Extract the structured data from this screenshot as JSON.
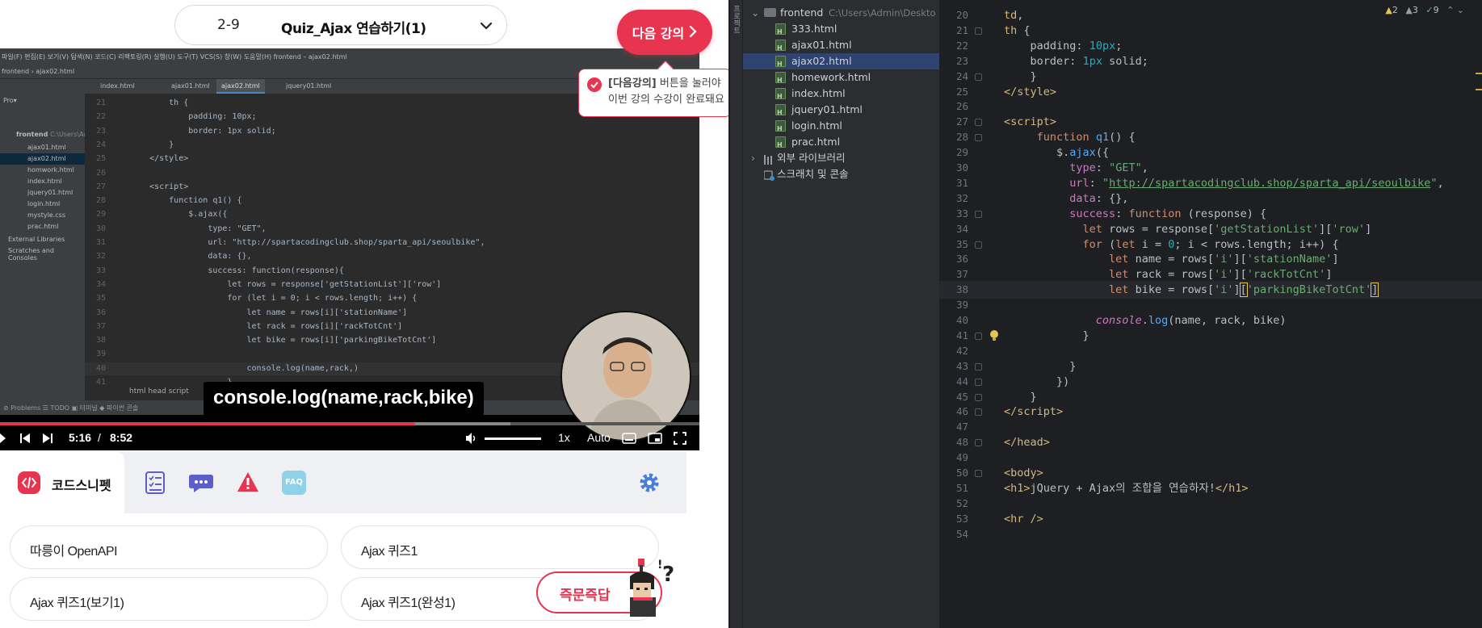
{
  "lecture": {
    "number": "2-9",
    "title": "Quiz_Ajax 연습하기(1)",
    "next_label": "다음 강의",
    "toast_bold": "[다음강의]",
    "toast_line1_rest": " 버튼을 눌러야",
    "toast_line2": "이번 강의 수강이 완료돼요"
  },
  "video": {
    "subtitle": "console.log(name,rack,bike)",
    "current_time": "5:16",
    "time_sep": "/",
    "duration": "8:52",
    "progress_fraction": 0.593,
    "buffer_fraction": 0.73,
    "speed": "1x",
    "quality": "Auto",
    "colors": {
      "accent": "#e8344e"
    },
    "ide": {
      "menu": "파일(F)   편집(E)   보기(V)   탐색(N)   코드(C)   리팩토링(R)   실행(U)   도구(T)   VCS(S)   창(W)   도움말(H)      frontend – ajax02.html",
      "nav": "frontend  ›  ajax02.html",
      "tabs": [
        "index.html",
        "ajax01.html",
        "ajax02.html",
        "jquery01.html"
      ],
      "project_title": "Pro▾",
      "project_root": "frontend",
      "project_root_path": "C:\\Users\\Ad",
      "files": [
        "ajax01.html",
        "ajax02.html",
        "homwork.html",
        "index.html",
        "jquery01.html",
        "login.html",
        "mystyle.css",
        "prac.html"
      ],
      "ext_libs": "External Libraries",
      "scratches": "Scratches and Consoles",
      "lines": [
        {
          "n": "21",
          "code": "        th {"
        },
        {
          "n": "22",
          "code": "            padding: 10px;"
        },
        {
          "n": "23",
          "code": "            border: 1px solid;"
        },
        {
          "n": "24",
          "code": "        }"
        },
        {
          "n": "25",
          "code": "    </style>"
        },
        {
          "n": "26",
          "code": ""
        },
        {
          "n": "27",
          "code": "    <script>"
        },
        {
          "n": "28",
          "code": "        function q1() {"
        },
        {
          "n": "29",
          "code": "            $.ajax({"
        },
        {
          "n": "30",
          "code": "                type: \"GET\","
        },
        {
          "n": "31",
          "code": "                url: \"http://spartacodingclub.shop/sparta_api/seoulbike\","
        },
        {
          "n": "32",
          "code": "                data: {},"
        },
        {
          "n": "33",
          "code": "                success: function(response){"
        },
        {
          "n": "34",
          "code": "                    let rows = response['getStationList']['row']"
        },
        {
          "n": "35",
          "code": "                    for (let i = 0; i < rows.length; i++) {"
        },
        {
          "n": "36",
          "code": "                        let name = rows[i]['stationName']"
        },
        {
          "n": "37",
          "code": "                        let rack = rows[i]['rackTotCnt']"
        },
        {
          "n": "38",
          "code": "                        let bike = rows[i]['parkingBikeTotCnt']"
        },
        {
          "n": "39",
          "code": ""
        },
        {
          "n": "40",
          "code": "                        console.log(name,rack,)"
        },
        {
          "n": "41",
          "code": "                    }"
        }
      ],
      "breadcrumb": "html    head    script",
      "status": "⊘ Problems    ☰ TODO    ▣ 터미널    ◆ 파이썬 콘솔"
    }
  },
  "snippets": {
    "tabs": [
      {
        "label": "코드스니펫",
        "icon": "code-icon"
      },
      {
        "label": "",
        "icon": "checklist-icon"
      },
      {
        "label": "",
        "icon": "chat-icon"
      },
      {
        "label": "",
        "icon": "warning-icon"
      },
      {
        "label": "FAQ",
        "icon": "faq-icon"
      }
    ],
    "settings_icon": "gear-icon",
    "cards": [
      "따릉이 OpenAPI",
      "Ajax 퀴즈1",
      "Ajax 퀴즈1(보기1)",
      "Ajax 퀴즈1(완성1)"
    ],
    "instant_answer": "즉문즉답"
  },
  "ide": {
    "side_strip_label": "프로젝트",
    "project": {
      "root": "frontend",
      "root_path": "C:\\Users\\Admin\\Deskto",
      "files": [
        "333.html",
        "ajax01.html",
        "ajax02.html",
        "homework.html",
        "index.html",
        "jquery01.html",
        "login.html",
        "prac.html"
      ],
      "selected_file": "ajax02.html",
      "external_libs": "외부 라이브러리",
      "scratches": "스크래치 및 콘솔"
    },
    "inspections": {
      "warnings": "2",
      "weak_warnings": "3",
      "ok": "9"
    },
    "code_lines": [
      {
        "n": "20",
        "html": "<span class=\"t-tag\">td</span><span class=\"t-plain\">,</span>"
      },
      {
        "n": "21",
        "html": "<span class=\"t-tag\">th</span><span class=\"t-plain\"> {</span>"
      },
      {
        "n": "22",
        "html": "    <span class=\"t-prop\">padding</span><span class=\"t-plain\">: </span><span class=\"t-num\">10px</span><span class=\"t-plain\">;</span>"
      },
      {
        "n": "23",
        "html": "    <span class=\"t-prop\">border</span><span class=\"t-plain\">: </span><span class=\"t-num\">1px</span><span class=\"t-plain\"> solid;</span>"
      },
      {
        "n": "24",
        "html": "    <span class=\"t-plain\">}</span>"
      },
      {
        "n": "25",
        "html": "<span class=\"t-tag\">&lt;/style&gt;</span>"
      },
      {
        "n": "26",
        "html": ""
      },
      {
        "n": "27",
        "html": "<span class=\"t-tag\">&lt;script&gt;</span>"
      },
      {
        "n": "28",
        "html": "     <span class=\"t-kw\">function</span> <span class=\"t-fn\">q1</span><span class=\"t-plain\">() {</span>"
      },
      {
        "n": "29",
        "html": "        <span class=\"t-plain\">$.</span><span class=\"t-fn\">ajax</span><span class=\"t-plain\">({</span>"
      },
      {
        "n": "30",
        "html": "          <span class=\"t-field\">type</span><span class=\"t-plain\">: </span><span class=\"t-str\">\"GET\"</span><span class=\"t-plain\">,</span>"
      },
      {
        "n": "31",
        "html": "          <span class=\"t-field\">url</span><span class=\"t-plain\">: </span><span class=\"t-str\">\"</span><span class=\"t-url\">http://spartacodingclub.shop/sparta_api/seoulbike</span><span class=\"t-str\">\"</span><span class=\"t-plain\">,</span>"
      },
      {
        "n": "32",
        "html": "          <span class=\"t-field\">data</span><span class=\"t-plain\">: {},</span>"
      },
      {
        "n": "33",
        "html": "          <span class=\"t-field\">success</span><span class=\"t-plain\">: </span><span class=\"t-kw\">function</span><span class=\"t-plain\"> (response) {</span>"
      },
      {
        "n": "34",
        "html": "            <span class=\"t-kw\">let</span><span class=\"t-plain\"> rows = response[</span><span class=\"t-str\">'getStationList'</span><span class=\"t-plain\">][</span><span class=\"t-str\">'row'</span><span class=\"t-plain\">]</span>"
      },
      {
        "n": "35",
        "html": "            <span class=\"t-kw\">for</span><span class=\"t-plain\"> (</span><span class=\"t-kw\">let</span><span class=\"t-plain\"> i = </span><span class=\"t-num\">0</span><span class=\"t-plain\">; i &lt; rows.length; i++) {</span>"
      },
      {
        "n": "36",
        "html": "                <span class=\"t-kw\">let</span><span class=\"t-plain\"> name = rows[</span><span class=\"t-str\">'i'</span><span class=\"t-plain\">][</span><span class=\"t-str\">'stationName'</span><span class=\"t-plain\">]</span>"
      },
      {
        "n": "37",
        "html": "                <span class=\"t-kw\">let</span><span class=\"t-plain\"> rack = rows[</span><span class=\"t-str\">'i'</span><span class=\"t-plain\">][</span><span class=\"t-str\">'rackTotCnt'</span><span class=\"t-plain\">]</span>"
      },
      {
        "n": "38",
        "html": "                <span class=\"t-kw\">let</span><span class=\"t-plain\"> bike = rows[</span><span class=\"t-str\">'i'</span><span class=\"t-plain\">]</span><span class=\"t-bracket\">[</span><span class=\"t-str\">'parkingBikeTotCnt'</span><span class=\"t-bracket\">]</span>"
      },
      {
        "n": "39",
        "html": ""
      },
      {
        "n": "40",
        "html": "              <span class=\"t-console\">console</span><span class=\"t-plain\">.</span><span class=\"t-fn\">log</span><span class=\"t-plain\">(name, rack, bike)</span>"
      },
      {
        "n": "41",
        "html": "            <span class=\"t-plain\">}</span>"
      },
      {
        "n": "42",
        "html": ""
      },
      {
        "n": "43",
        "html": "          <span class=\"t-plain\">}</span>"
      },
      {
        "n": "44",
        "html": "        <span class=\"t-plain\">})</span>"
      },
      {
        "n": "45",
        "html": "    <span class=\"t-plain\">}</span>"
      },
      {
        "n": "46",
        "html": "<span class=\"t-tag\">&lt;/script&gt;</span>"
      },
      {
        "n": "47",
        "html": ""
      },
      {
        "n": "48",
        "html": "<span class=\"t-tag\">&lt;/head&gt;</span>"
      },
      {
        "n": "49",
        "html": ""
      },
      {
        "n": "50",
        "html": "<span class=\"t-tag\">&lt;body&gt;</span>"
      },
      {
        "n": "51",
        "html": "<span class=\"t-tag\">&lt;h1&gt;</span><span class=\"t-plain\">jQuery + Ajax의 조합을 연습하자!</span><span class=\"t-tag\">&lt;/h1&gt;</span>"
      },
      {
        "n": "52",
        "html": ""
      },
      {
        "n": "53",
        "html": "<span class=\"t-tag\">&lt;hr /&gt;</span>"
      },
      {
        "n": "54",
        "html": ""
      }
    ],
    "current_line": "38"
  }
}
